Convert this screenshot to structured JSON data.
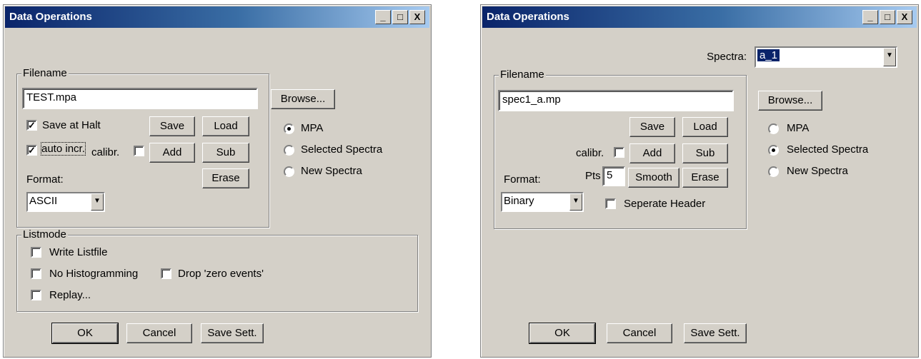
{
  "left": {
    "title": "Data Operations",
    "title_buttons": [
      "_",
      "□",
      "X"
    ],
    "filename_group": "Filename",
    "filename_value": "TEST.mpa",
    "browse": "Browse...",
    "save_at_halt": "Save at Halt",
    "auto_incr": "auto incr.",
    "calibr": "calibr.",
    "save": "Save",
    "load": "Load",
    "add": "Add",
    "sub": "Sub",
    "erase": "Erase",
    "format_label": "Format:",
    "format_value": "ASCII",
    "radios": [
      "MPA",
      "Selected Spectra",
      "New Spectra"
    ],
    "listmode_group": "Listmode",
    "write_listfile": "Write Listfile",
    "no_histogramming": "No Histogramming",
    "drop_zero": "Drop 'zero events'",
    "replay": "Replay...",
    "ok": "OK",
    "cancel": "Cancel",
    "save_sett": "Save Sett."
  },
  "right": {
    "title": "Data Operations",
    "title_buttons": [
      "_",
      "□",
      "X"
    ],
    "spectra_label": "Spectra:",
    "spectra_value": "a_1",
    "filename_group": "Filename",
    "filename_value": "spec1_a.mp",
    "browse": "Browse...",
    "save": "Save",
    "load": "Load",
    "calibr": "calibr.",
    "add": "Add",
    "sub": "Sub",
    "pts_label": "Pts",
    "pts_value": "5",
    "smooth": "Smooth",
    "erase": "Erase",
    "format_label": "Format:",
    "format_value": "Binary",
    "separate_header": "Seperate Header",
    "radios": [
      "MPA",
      "Selected Spectra",
      "New Spectra"
    ],
    "ok": "OK",
    "cancel": "Cancel",
    "save_sett": "Save Sett."
  },
  "colors": {
    "titlebar_start": "#0a246a",
    "titlebar_end": "#a6caf0",
    "face": "#d4d0c8"
  }
}
